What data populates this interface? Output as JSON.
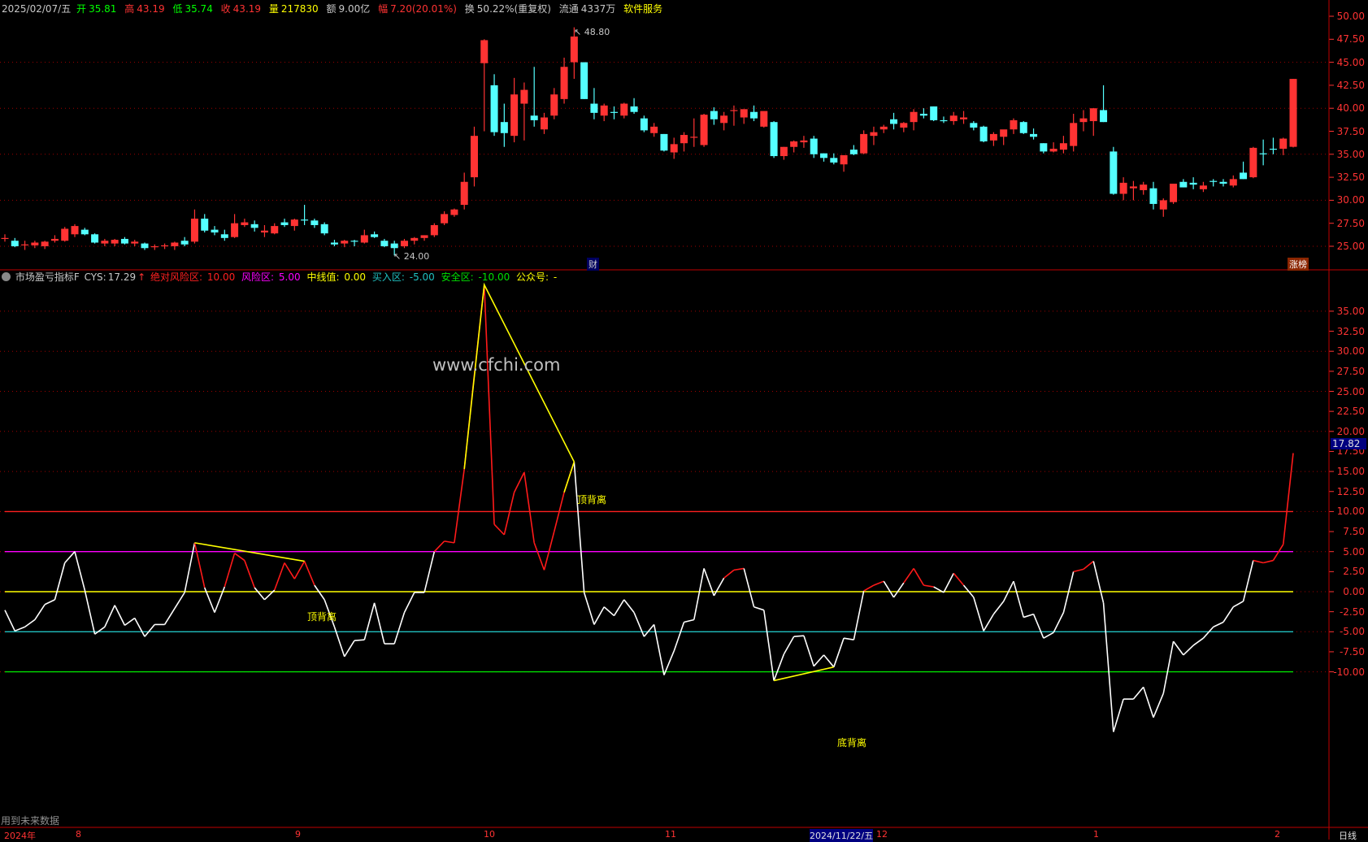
{
  "header": {
    "date": "2025/02/07/五",
    "open_label": "开",
    "open": "35.81",
    "high_label": "高",
    "high": "43.19",
    "low_label": "低",
    "low": "35.74",
    "close_label": "收",
    "close": "43.19",
    "volume_label": "量",
    "volume": "217830",
    "amount_label": "额",
    "amount": "9.00亿",
    "change_label": "幅",
    "change": "7.20(20.01%)",
    "turnover_label": "换",
    "turnover": "50.22%(重复权)",
    "float_label": "流通",
    "float": "4337万",
    "service": "软件服务"
  },
  "indicator": {
    "name": "市场盈亏指标F",
    "cys_label": "CYS:",
    "cys": "17.29",
    "arrow": "↑",
    "abs_risk_label": "绝对风险区:",
    "abs_risk": "10.00",
    "risk_label": "风险区:",
    "risk": "5.00",
    "mid_label": "中线值:",
    "mid": "0.00",
    "buy_label": "买入区:",
    "buy": "-5.00",
    "safe_label": "安全区:",
    "safe": "-10.00",
    "wechat_label": "公众号:",
    "wechat": "-"
  },
  "colors": {
    "up": "#ff3333",
    "down": "#54ffff",
    "axis": "#c00000",
    "abs_risk": "#ff2020",
    "risk": "#ff00ff",
    "mid": "#ffff00",
    "buy": "#20c0c0",
    "safe": "#00e000"
  },
  "price_axis": [
    "50.00",
    "47.50",
    "45.00",
    "42.50",
    "40.00",
    "37.50",
    "35.00",
    "32.50",
    "30.00",
    "27.50",
    "25.00"
  ],
  "ind_axis": [
    "35.00",
    "32.50",
    "30.00",
    "27.50",
    "25.00",
    "22.50",
    "20.00",
    "17.50",
    "15.00",
    "12.50",
    "10.00",
    "7.50",
    "5.00",
    "2.50",
    "0.00",
    "-2.50",
    "-5.00",
    "-7.50",
    "-10.00"
  ],
  "current_value": "17.82",
  "max_marker": "48.80",
  "min_marker": "24.00",
  "finance_tag": "财",
  "rank_tag": "涨榜",
  "watermark": "www.cfchi.com",
  "future_data_note": "用到未来数据",
  "time_axis": {
    "year": "2024年",
    "months": [
      "8",
      "9",
      "10",
      "11",
      "12",
      "1",
      "2"
    ],
    "cursor": "2024/11/22/五",
    "period": "日线"
  },
  "divergence": {
    "top": "顶背离",
    "bottom": "底背离"
  },
  "chart_data": [
    {
      "type": "candlestick",
      "title": "K线",
      "ylim": [
        24,
        50
      ],
      "ohlc": [
        [
          25.8,
          26.3,
          25.5,
          25.9
        ],
        [
          25.6,
          25.9,
          24.9,
          25.0
        ],
        [
          25.1,
          25.6,
          24.6,
          25.2
        ],
        [
          25.1,
          25.6,
          24.8,
          25.4
        ],
        [
          25.0,
          25.6,
          24.7,
          25.5
        ],
        [
          25.6,
          26.2,
          25.4,
          25.8
        ],
        [
          25.6,
          27.1,
          25.5,
          26.9
        ],
        [
          26.3,
          27.4,
          26.0,
          27.2
        ],
        [
          26.8,
          27.0,
          26.2,
          26.3
        ],
        [
          26.3,
          26.4,
          25.3,
          25.4
        ],
        [
          25.3,
          25.8,
          25.0,
          25.6
        ],
        [
          25.3,
          25.8,
          25.0,
          25.7
        ],
        [
          25.8,
          26.0,
          25.2,
          25.3
        ],
        [
          25.3,
          25.7,
          25.0,
          25.5
        ],
        [
          25.3,
          25.4,
          24.6,
          24.8
        ],
        [
          24.9,
          25.2,
          24.6,
          25.0
        ],
        [
          25.0,
          25.3,
          24.7,
          25.1
        ],
        [
          25.0,
          25.5,
          24.6,
          25.4
        ],
        [
          25.6,
          26.0,
          25.0,
          25.2
        ],
        [
          25.5,
          29.0,
          25.3,
          28.0
        ],
        [
          28.0,
          28.5,
          26.5,
          26.7
        ],
        [
          26.8,
          27.2,
          26.2,
          26.5
        ],
        [
          26.3,
          26.8,
          25.6,
          25.9
        ],
        [
          26.0,
          28.5,
          25.9,
          27.5
        ],
        [
          27.3,
          28.0,
          27.1,
          27.6
        ],
        [
          27.4,
          27.8,
          26.6,
          27.0
        ],
        [
          26.5,
          27.3,
          26.0,
          26.7
        ],
        [
          26.4,
          27.5,
          26.3,
          27.2
        ],
        [
          27.6,
          28.0,
          27.1,
          27.3
        ],
        [
          27.2,
          28.0,
          26.7,
          27.9
        ],
        [
          27.9,
          29.5,
          27.3,
          27.8
        ],
        [
          27.8,
          28.0,
          27.0,
          27.3
        ],
        [
          27.4,
          27.6,
          26.2,
          26.4
        ],
        [
          25.4,
          25.7,
          25.0,
          25.2
        ],
        [
          25.3,
          25.7,
          24.9,
          25.6
        ],
        [
          25.6,
          25.7,
          25.0,
          25.5
        ],
        [
          25.4,
          26.8,
          25.3,
          26.2
        ],
        [
          26.3,
          26.6,
          25.9,
          26.0
        ],
        [
          25.6,
          25.8,
          24.9,
          25.0
        ],
        [
          25.3,
          25.6,
          24.0,
          24.8
        ],
        [
          25.0,
          25.8,
          24.8,
          25.6
        ],
        [
          25.6,
          26.0,
          25.2,
          25.9
        ],
        [
          25.9,
          26.2,
          25.6,
          26.2
        ],
        [
          26.2,
          27.5,
          26.0,
          27.3
        ],
        [
          27.5,
          28.8,
          27.3,
          28.5
        ],
        [
          28.4,
          29.1,
          28.2,
          29.0
        ],
        [
          29.5,
          33.0,
          29.0,
          32.0
        ],
        [
          32.5,
          38.0,
          31.5,
          37.0
        ],
        [
          44.9,
          47.5,
          37.5,
          47.4
        ],
        [
          42.5,
          43.7,
          37.0,
          37.4
        ],
        [
          38.5,
          40.5,
          35.8,
          37.3
        ],
        [
          37.0,
          43.3,
          36.3,
          41.5
        ],
        [
          40.5,
          42.8,
          36.5,
          42.0
        ],
        [
          39.2,
          44.5,
          38.0,
          38.7
        ],
        [
          37.7,
          39.5,
          37.2,
          39.0
        ],
        [
          39.2,
          42.2,
          38.8,
          41.5
        ],
        [
          41.0,
          45.5,
          40.5,
          44.5
        ],
        [
          45.0,
          48.8,
          43.2,
          47.8
        ],
        [
          45.0,
          45.0,
          41.0,
          41.0
        ],
        [
          40.5,
          42.2,
          38.8,
          39.5
        ],
        [
          39.2,
          40.5,
          38.6,
          40.3
        ],
        [
          39.6,
          40.2,
          38.8,
          39.5
        ],
        [
          39.2,
          40.6,
          38.9,
          40.5
        ],
        [
          40.2,
          41.1,
          39.4,
          39.6
        ],
        [
          38.9,
          39.2,
          37.4,
          37.6
        ],
        [
          37.3,
          38.4,
          36.9,
          38.0
        ],
        [
          37.2,
          37.2,
          35.3,
          35.4
        ],
        [
          35.2,
          36.8,
          34.5,
          36.1
        ],
        [
          36.2,
          37.4,
          35.3,
          37.1
        ],
        [
          36.8,
          38.9,
          35.8,
          36.9
        ],
        [
          36.0,
          39.4,
          35.8,
          39.3
        ],
        [
          39.7,
          40.1,
          38.2,
          38.8
        ],
        [
          38.4,
          39.6,
          37.6,
          39.2
        ],
        [
          39.8,
          40.3,
          38.1,
          39.8
        ],
        [
          39.0,
          39.9,
          38.3,
          39.9
        ],
        [
          39.6,
          40.3,
          38.6,
          38.9
        ],
        [
          38.0,
          39.6,
          37.9,
          39.7
        ],
        [
          38.5,
          38.6,
          34.6,
          34.8
        ],
        [
          34.8,
          35.8,
          34.4,
          35.8
        ],
        [
          35.8,
          36.5,
          35.2,
          36.4
        ],
        [
          36.3,
          37.0,
          35.7,
          36.5
        ],
        [
          36.7,
          37.0,
          34.6,
          35.0
        ],
        [
          35.1,
          35.1,
          34.2,
          34.6
        ],
        [
          34.6,
          35.1,
          33.9,
          34.1
        ],
        [
          33.9,
          34.8,
          33.1,
          34.9
        ],
        [
          35.5,
          36.0,
          34.9,
          35.0
        ],
        [
          35.1,
          37.6,
          35.0,
          37.2
        ],
        [
          37.0,
          38.0,
          36.0,
          37.4
        ],
        [
          37.7,
          38.2,
          37.3,
          38.0
        ],
        [
          38.8,
          39.5,
          37.7,
          38.3
        ],
        [
          37.9,
          38.5,
          37.4,
          38.4
        ],
        [
          38.5,
          39.9,
          37.6,
          39.6
        ],
        [
          39.4,
          40.0,
          38.9,
          39.2
        ],
        [
          40.2,
          40.2,
          38.6,
          38.7
        ],
        [
          38.7,
          39.1,
          38.4,
          38.6
        ],
        [
          38.6,
          39.6,
          38.2,
          39.2
        ],
        [
          38.8,
          39.7,
          38.3,
          39.0
        ],
        [
          38.4,
          38.6,
          37.6,
          37.9
        ],
        [
          38.0,
          38.1,
          36.3,
          36.4
        ],
        [
          36.5,
          37.4,
          35.9,
          37.2
        ],
        [
          36.9,
          37.6,
          36.0,
          37.7
        ],
        [
          37.7,
          38.9,
          37.2,
          38.7
        ],
        [
          38.5,
          38.6,
          37.2,
          37.3
        ],
        [
          37.2,
          37.8,
          36.6,
          36.9
        ],
        [
          36.2,
          36.2,
          35.1,
          35.3
        ],
        [
          35.3,
          36.3,
          35.2,
          35.6
        ],
        [
          35.5,
          37.0,
          35.1,
          36.2
        ],
        [
          35.9,
          39.4,
          35.3,
          38.4
        ],
        [
          38.5,
          39.8,
          37.5,
          38.9
        ],
        [
          38.6,
          40.0,
          37.0,
          40.0
        ],
        [
          39.8,
          42.5,
          38.5,
          38.5
        ],
        [
          35.3,
          35.8,
          30.6,
          30.7
        ],
        [
          30.7,
          32.5,
          30.0,
          31.9
        ],
        [
          31.3,
          32.1,
          30.0,
          31.5
        ],
        [
          31.1,
          32.0,
          30.6,
          31.7
        ],
        [
          31.3,
          32.0,
          29.0,
          29.6
        ],
        [
          29.0,
          30.2,
          28.2,
          30.0
        ],
        [
          29.8,
          31.8,
          29.6,
          31.8
        ],
        [
          32.0,
          32.3,
          31.4,
          31.4
        ],
        [
          31.9,
          32.5,
          31.2,
          31.7
        ],
        [
          31.2,
          32.0,
          30.9,
          31.6
        ],
        [
          32.1,
          32.3,
          31.5,
          32.0
        ],
        [
          32.0,
          32.3,
          31.5,
          31.8
        ],
        [
          31.6,
          32.7,
          31.4,
          32.3
        ],
        [
          33.0,
          34.2,
          32.3,
          32.3
        ],
        [
          32.5,
          35.8,
          32.4,
          35.7
        ],
        [
          35.1,
          36.6,
          33.8,
          35.0
        ],
        [
          35.6,
          36.8,
          35.0,
          35.5
        ],
        [
          35.6,
          36.8,
          34.9,
          36.7
        ],
        [
          35.81,
          43.19,
          35.74,
          43.19
        ]
      ]
    },
    {
      "type": "line",
      "title": "市场盈亏指标F CYS",
      "ylim": [
        -20,
        40
      ],
      "hlines": [
        10,
        5,
        0,
        -5,
        -10
      ],
      "values": [
        -2.3,
        -4.9,
        -4.4,
        -3.5,
        -1.6,
        -1,
        3.6,
        5.0,
        0.2,
        -5.3,
        -4.4,
        -1.7,
        -4.2,
        -3.3,
        -5.6,
        -4.1,
        -4.1,
        -2.1,
        -0.1,
        6.1,
        0.5,
        -2.6,
        0.6,
        4.8,
        3.9,
        0.5,
        -1,
        0.2,
        3.6,
        1.6,
        3.8,
        0.8,
        -1,
        -4.4,
        -8.1,
        -6.1,
        -6.0,
        -1.4,
        -6.5,
        -6.5,
        -2.6,
        -0.1,
        -0.1,
        5.0,
        6.3,
        6.1,
        15.3,
        27,
        38.3,
        8.4,
        7.1,
        12.4,
        14.9,
        6.1,
        2.7,
        7.5,
        12.4,
        16.2,
        -0.1,
        -4.1,
        -1.9,
        -3.0,
        -1.0,
        -2.6,
        -5.6,
        -4.1,
        -10.4,
        -7.4,
        -3.8,
        -3.5,
        2.9,
        -0.5,
        1.7,
        2.7,
        2.9,
        -1.9,
        -2.3,
        -11.1,
        -7.8,
        -5.6,
        -5.5,
        -9.3,
        -7.9,
        -9.4,
        -5.8,
        -6.0,
        0.1,
        0.8,
        1.3,
        -0.7,
        1.1,
        2.9,
        0.8,
        0.6,
        -0.1,
        2.3,
        0.8,
        -0.7,
        -4.9,
        -2.8,
        -1.2,
        1.3,
        -3.2,
        -2.8,
        -5.8,
        -5.1,
        -2.6,
        2.5,
        2.8,
        3.8,
        -1.4,
        -17.5,
        -13.4,
        -13.4,
        -11.9,
        -15.7,
        -12.7,
        -6.2,
        -7.9,
        -6.7,
        -5.8,
        -4.4,
        -3.8,
        -1.9,
        -1.2,
        3.9,
        3.6,
        3.9,
        5.9,
        17.29
      ],
      "divergences": [
        {
          "kind": "top",
          "points": [
            19,
            30
          ]
        },
        {
          "kind": "top",
          "points": [
            46,
            48,
            57
          ]
        },
        {
          "kind": "top",
          "points": [
            56,
            57
          ]
        },
        {
          "kind": "bottom",
          "points": [
            77,
            83
          ]
        }
      ]
    }
  ]
}
